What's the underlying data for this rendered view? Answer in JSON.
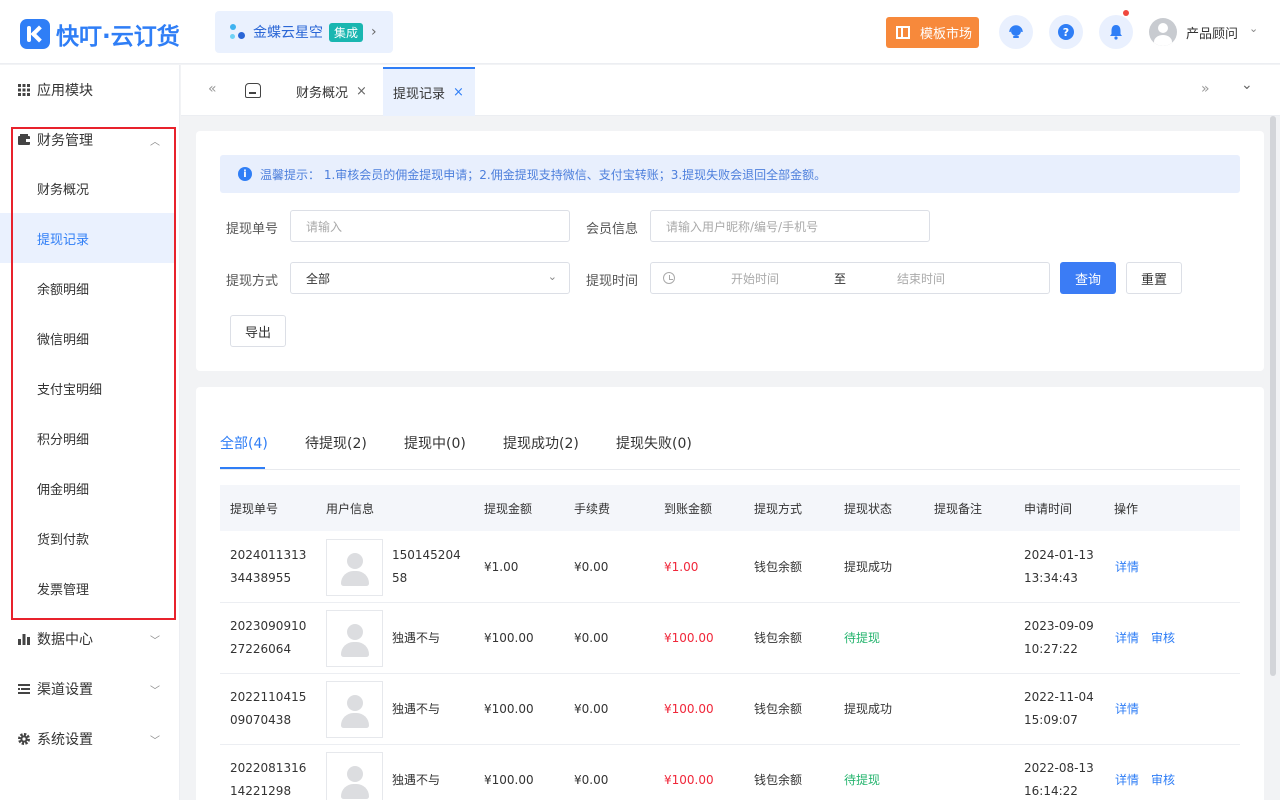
{
  "header": {
    "app_name": "快叮·云订货",
    "kd_label": "金蝶云星空",
    "kd_badge": "集成",
    "market_label": "模板市场",
    "help_glyph": "?",
    "user_name": "产品顾问",
    "icons": [
      "logo-icon",
      "kingdee-icon",
      "template-icon",
      "service-icon",
      "help-icon",
      "bell-icon",
      "avatar",
      "chevron-down-icon"
    ],
    "brand_color": "#2f7ef6",
    "market_color": "#f7893b"
  },
  "sidebar": {
    "groups": [
      {
        "label": "应用模块",
        "icon": "grid-icon"
      },
      {
        "label": "财务管理",
        "icon": "wallet-icon",
        "expanded": true
      },
      {
        "label": "数据中心",
        "icon": "bar-chart-icon"
      },
      {
        "label": "渠道设置",
        "icon": "list-icon"
      },
      {
        "label": "系统设置",
        "icon": "gear-icon"
      }
    ],
    "finance_items": [
      {
        "label": "财务概况"
      },
      {
        "label": "提现记录",
        "active": true
      },
      {
        "label": "余额明细"
      },
      {
        "label": "微信明细"
      },
      {
        "label": "支付宝明细"
      },
      {
        "label": "积分明细"
      },
      {
        "label": "佣金明细"
      },
      {
        "label": "货到付款"
      },
      {
        "label": "发票管理"
      }
    ]
  },
  "tabs": {
    "items": [
      {
        "label": "财务概况"
      },
      {
        "label": "提现记录",
        "active": true
      }
    ],
    "close_glyph": "×",
    "prev_glyph": "«",
    "next_glyph": "»",
    "more_glyph": "⌄"
  },
  "filters": {
    "notice": "温馨提示：  1.审核会员的佣金提现申请；2.佣金提现支持微信、支付宝转账；3.提现失败会退回全部金额。",
    "info_glyph": "i",
    "order_no_label": "提现单号",
    "order_no_placeholder": "请输入",
    "member_label": "会员信息",
    "member_placeholder": "请输入用户昵称/编号/手机号",
    "method_label": "提现方式",
    "method_value": "全部",
    "time_label": "提现时间",
    "start_placeholder": "开始时间",
    "range_sep": "至",
    "end_placeholder": "结束时间",
    "query_btn": "查询",
    "reset_btn": "重置",
    "export_btn": "导出",
    "primary_color": "#3b7cf5"
  },
  "status_tabs": [
    {
      "label": "全部(4)",
      "active": true
    },
    {
      "label": "待提现(2)"
    },
    {
      "label": "提现中(0)"
    },
    {
      "label": "提现成功(2)"
    },
    {
      "label": "提现失败(0)"
    }
  ],
  "table": {
    "columns": [
      "提现单号",
      "用户信息",
      "提现金额",
      "手续费",
      "到账金额",
      "提现方式",
      "提现状态",
      "提现备注",
      "申请时间",
      "操作"
    ],
    "rows": [
      {
        "order_no": "202401131334438955",
        "user": "15014520458",
        "amount": "¥1.00",
        "fee": "¥0.00",
        "received": "¥1.00",
        "method": "钱包余额",
        "status": "提现成功",
        "status_type": "success",
        "remark": "",
        "date": "2024-01-13",
        "time": "13:34:43",
        "actions": [
          "详情"
        ]
      },
      {
        "order_no": "202309091027226064",
        "user": "独遇不与",
        "amount": "¥100.00",
        "fee": "¥0.00",
        "received": "¥100.00",
        "method": "钱包余额",
        "status": "待提现",
        "status_type": "pending",
        "remark": "",
        "date": "2023-09-09",
        "time": "10:27:22",
        "actions": [
          "详情",
          "审核"
        ]
      },
      {
        "order_no": "202211041509070438",
        "user": "独遇不与",
        "amount": "¥100.00",
        "fee": "¥0.00",
        "received": "¥100.00",
        "method": "钱包余额",
        "status": "提现成功",
        "status_type": "success",
        "remark": "",
        "date": "2022-11-04",
        "time": "15:09:07",
        "actions": [
          "详情"
        ]
      },
      {
        "order_no": "202208131614221298",
        "user": "独遇不与",
        "amount": "¥100.00",
        "fee": "¥0.00",
        "received": "¥100.00",
        "method": "钱包余额",
        "status": "待提现",
        "status_type": "pending",
        "remark": "",
        "date": "2022-08-13",
        "time": "16:14:22",
        "actions": [
          "详情",
          "审核"
        ]
      }
    ],
    "amount_color": "#f0273a",
    "pending_color": "#25b46e"
  }
}
